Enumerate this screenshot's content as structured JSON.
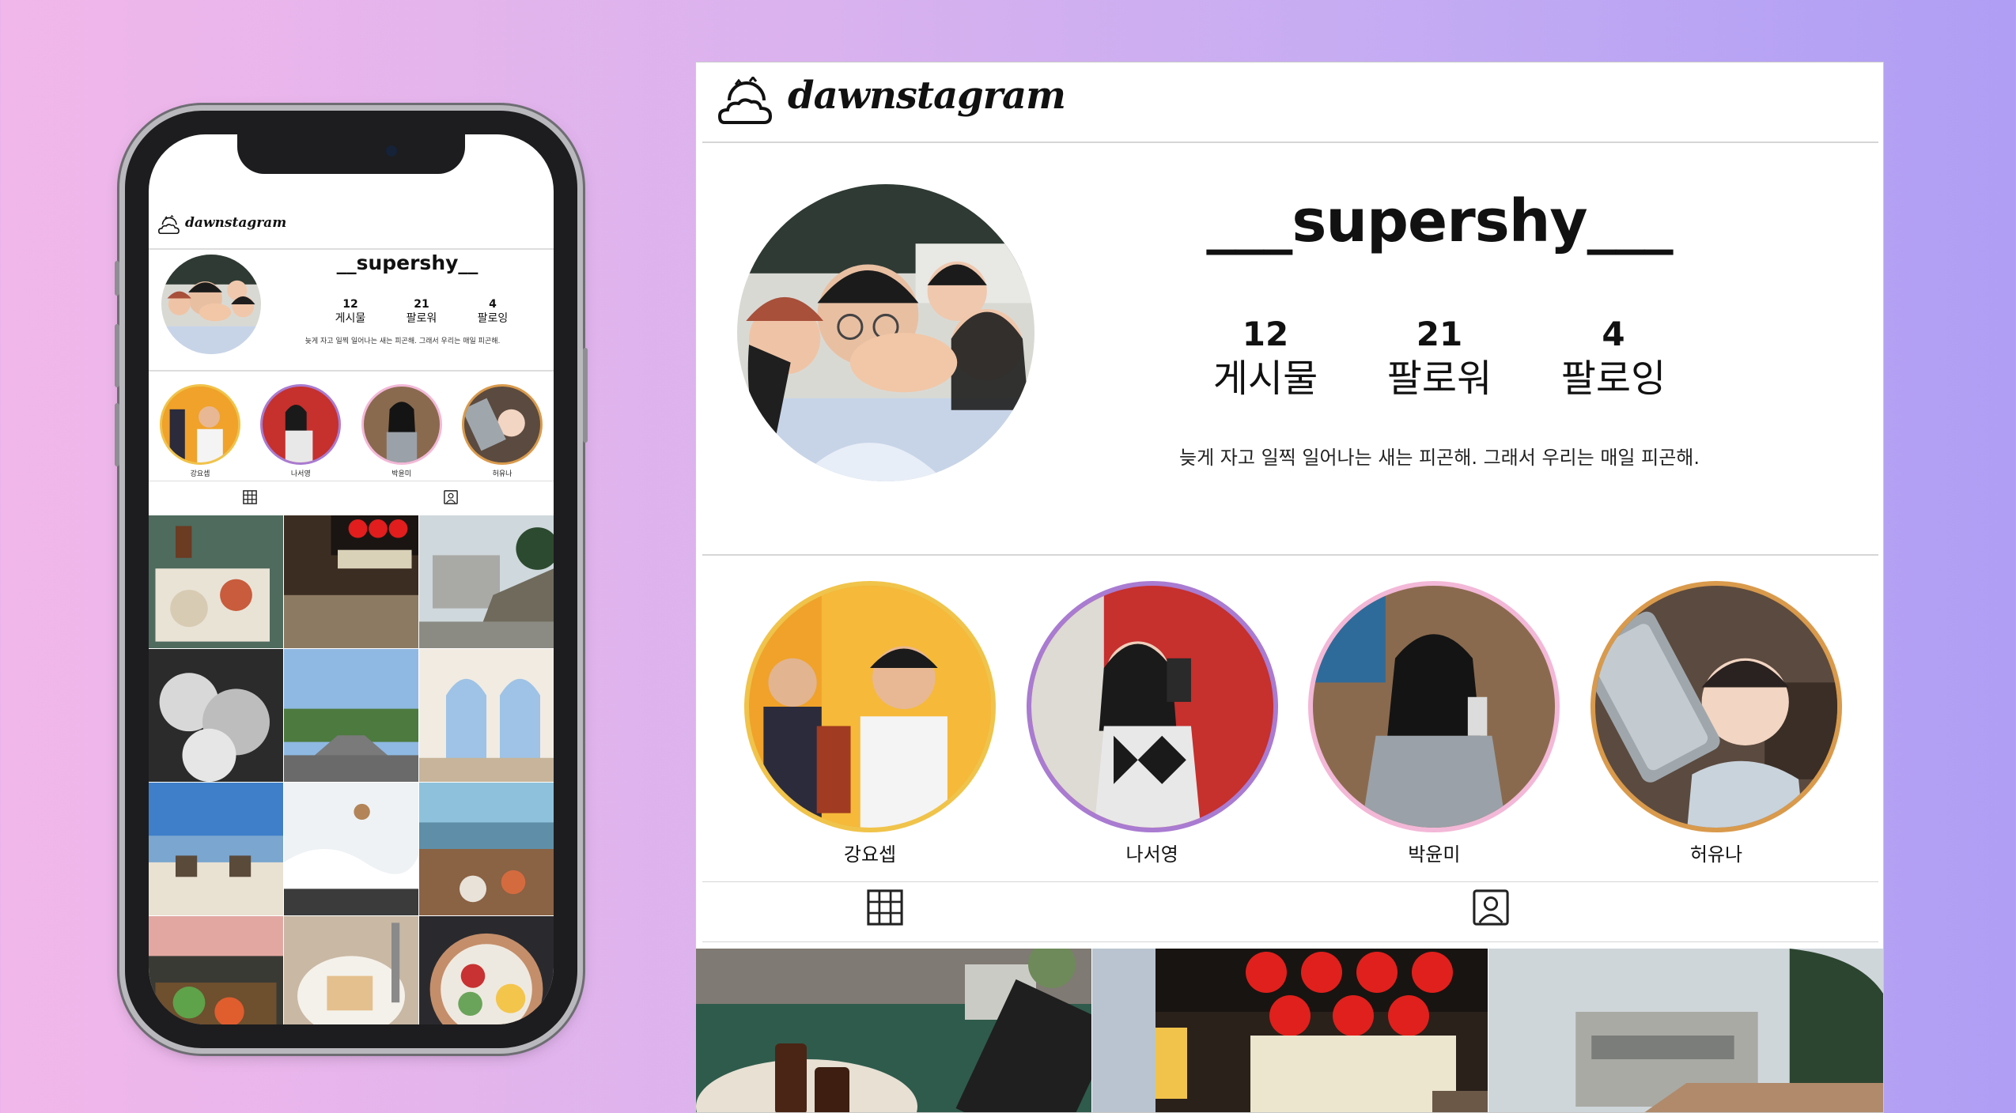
{
  "app": {
    "logo_text": "dawnstagram"
  },
  "profile": {
    "username": "___supershy___",
    "mobile_username": "__supershy__",
    "stats": [
      {
        "value": "12",
        "label": "게시물"
      },
      {
        "value": "21",
        "label": "팔로워"
      },
      {
        "value": "4",
        "label": "팔로잉"
      }
    ],
    "bio": "늦게 자고 일찍 일어나는 새는 피곤해. 그래서 우리는 매일 피곤해."
  },
  "stories": [
    {
      "name": "강요셉",
      "ring_color": "#f0c34a"
    },
    {
      "name": "나서영",
      "ring_color": "#a97bd1"
    },
    {
      "name": "박윤미",
      "ring_color": "#f3b8d7"
    },
    {
      "name": "허유나",
      "ring_color": "#d99a4c"
    }
  ],
  "tabs": {
    "grid_icon": "grid-icon",
    "tagged_icon": "person-tag-icon"
  },
  "posts": [
    {
      "name": "cafe-table"
    },
    {
      "name": "izakaya-lanterns"
    },
    {
      "name": "seaside-building"
    },
    {
      "name": "cherry-blossom"
    },
    {
      "name": "coastal-road"
    },
    {
      "name": "arched-window"
    },
    {
      "name": "beach-chairs"
    },
    {
      "name": "snow-scene"
    },
    {
      "name": "restaurant-view"
    },
    {
      "name": "brunch-plate"
    },
    {
      "name": "toast-plate"
    },
    {
      "name": "salad-bowl"
    }
  ],
  "desktop_posts_visible": [
    "cafe-table",
    "izakaya-lanterns",
    "seaside-building"
  ]
}
